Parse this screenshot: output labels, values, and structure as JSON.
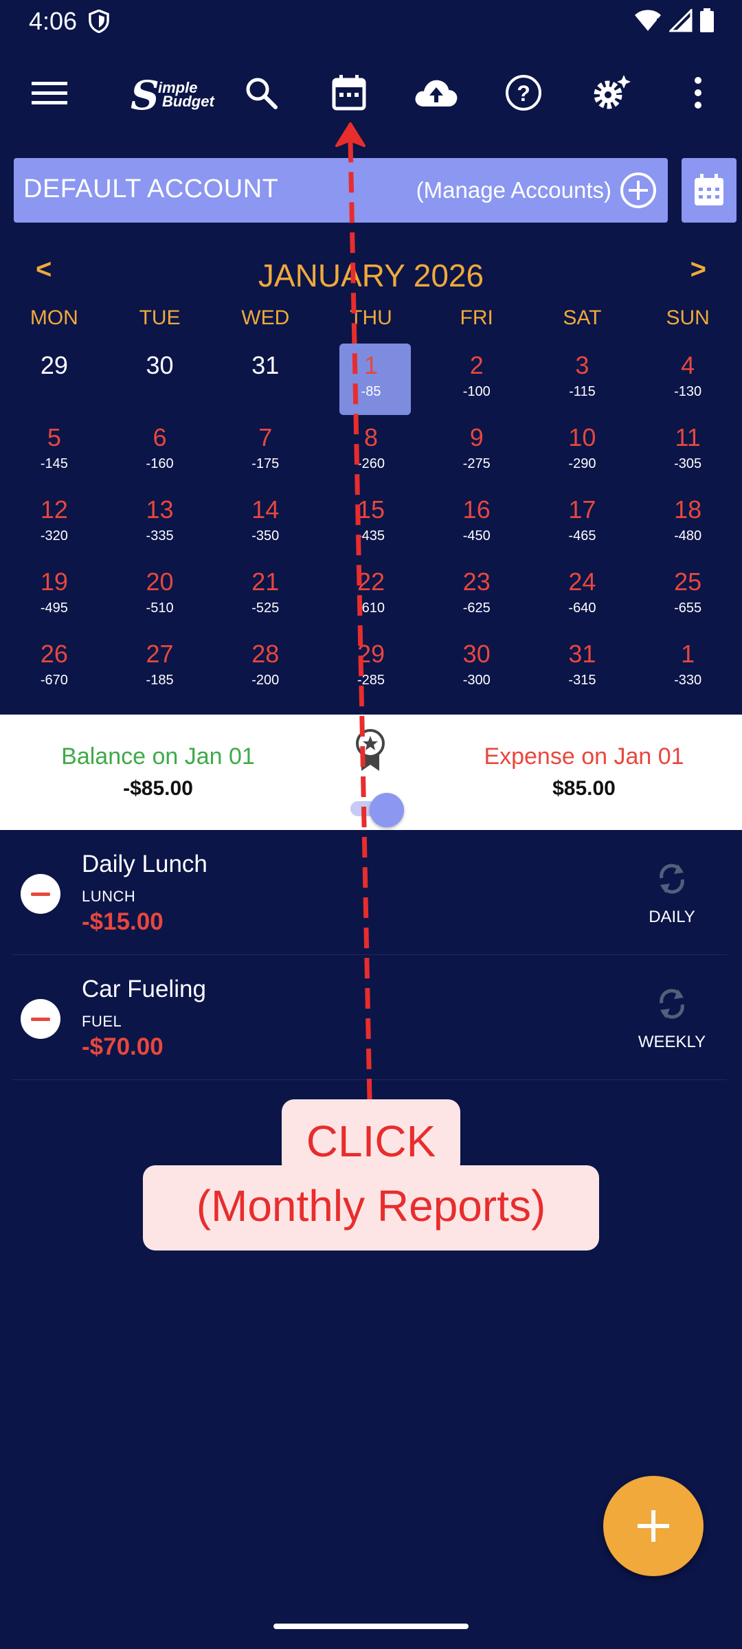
{
  "status_bar": {
    "time": "4:06"
  },
  "toolbar": {
    "logo_line1": "imple",
    "logo_line2": "Budget",
    "logo_s": "S"
  },
  "account": {
    "name": "DEFAULT ACCOUNT",
    "manage_label": "(Manage Accounts)"
  },
  "calendar": {
    "prev_label": "<",
    "next_label": ">",
    "month_title": "JANUARY 2026",
    "weekdays": [
      "MON",
      "TUE",
      "WED",
      "THU",
      "FRI",
      "SAT",
      "SUN"
    ],
    "days": [
      {
        "num": "29",
        "amt": "",
        "kind": "prev"
      },
      {
        "num": "30",
        "amt": "",
        "kind": "prev"
      },
      {
        "num": "31",
        "amt": "",
        "kind": "prev"
      },
      {
        "num": "1",
        "amt": "-85",
        "kind": "sel"
      },
      {
        "num": "2",
        "amt": "-100",
        "kind": "cur"
      },
      {
        "num": "3",
        "amt": "-115",
        "kind": "cur"
      },
      {
        "num": "4",
        "amt": "-130",
        "kind": "cur"
      },
      {
        "num": "5",
        "amt": "-145",
        "kind": "cur"
      },
      {
        "num": "6",
        "amt": "-160",
        "kind": "cur"
      },
      {
        "num": "7",
        "amt": "-175",
        "kind": "cur"
      },
      {
        "num": "8",
        "amt": "-260",
        "kind": "cur"
      },
      {
        "num": "9",
        "amt": "-275",
        "kind": "cur"
      },
      {
        "num": "10",
        "amt": "-290",
        "kind": "cur"
      },
      {
        "num": "11",
        "amt": "-305",
        "kind": "cur"
      },
      {
        "num": "12",
        "amt": "-320",
        "kind": "cur"
      },
      {
        "num": "13",
        "amt": "-335",
        "kind": "cur"
      },
      {
        "num": "14",
        "amt": "-350",
        "kind": "cur"
      },
      {
        "num": "15",
        "amt": "-435",
        "kind": "cur"
      },
      {
        "num": "16",
        "amt": "-450",
        "kind": "cur"
      },
      {
        "num": "17",
        "amt": "-465",
        "kind": "cur"
      },
      {
        "num": "18",
        "amt": "-480",
        "kind": "cur"
      },
      {
        "num": "19",
        "amt": "-495",
        "kind": "cur"
      },
      {
        "num": "20",
        "amt": "-510",
        "kind": "cur"
      },
      {
        "num": "21",
        "amt": "-525",
        "kind": "cur"
      },
      {
        "num": "22",
        "amt": "-610",
        "kind": "cur"
      },
      {
        "num": "23",
        "amt": "-625",
        "kind": "cur"
      },
      {
        "num": "24",
        "amt": "-640",
        "kind": "cur"
      },
      {
        "num": "25",
        "amt": "-655",
        "kind": "cur"
      },
      {
        "num": "26",
        "amt": "-670",
        "kind": "cur"
      },
      {
        "num": "27",
        "amt": "-185",
        "kind": "cur"
      },
      {
        "num": "28",
        "amt": "-200",
        "kind": "cur"
      },
      {
        "num": "29",
        "amt": "-285",
        "kind": "cur"
      },
      {
        "num": "30",
        "amt": "-300",
        "kind": "cur"
      },
      {
        "num": "31",
        "amt": "-315",
        "kind": "cur"
      },
      {
        "num": "1",
        "amt": "-330",
        "kind": "next"
      }
    ]
  },
  "summary": {
    "balance_label": "Balance on Jan 01",
    "balance_value": "-$85.00",
    "expense_label": "Expense on Jan 01",
    "expense_value": "$85.00"
  },
  "transactions": [
    {
      "name": "Daily Lunch",
      "category": "LUNCH",
      "amount": "-$15.00",
      "frequency": "DAILY"
    },
    {
      "name": "Car Fueling",
      "category": "FUEL",
      "amount": "-$70.00",
      "frequency": "WEEKLY"
    }
  ],
  "annotation": {
    "line1": "CLICK",
    "line2": "(Monthly Reports)"
  },
  "colors": {
    "background": "#0b1548",
    "accent_orange": "#f0a93a",
    "account_bar": "#8b97f0",
    "expense_red": "#e8473d",
    "balance_green": "#3eaa48"
  }
}
